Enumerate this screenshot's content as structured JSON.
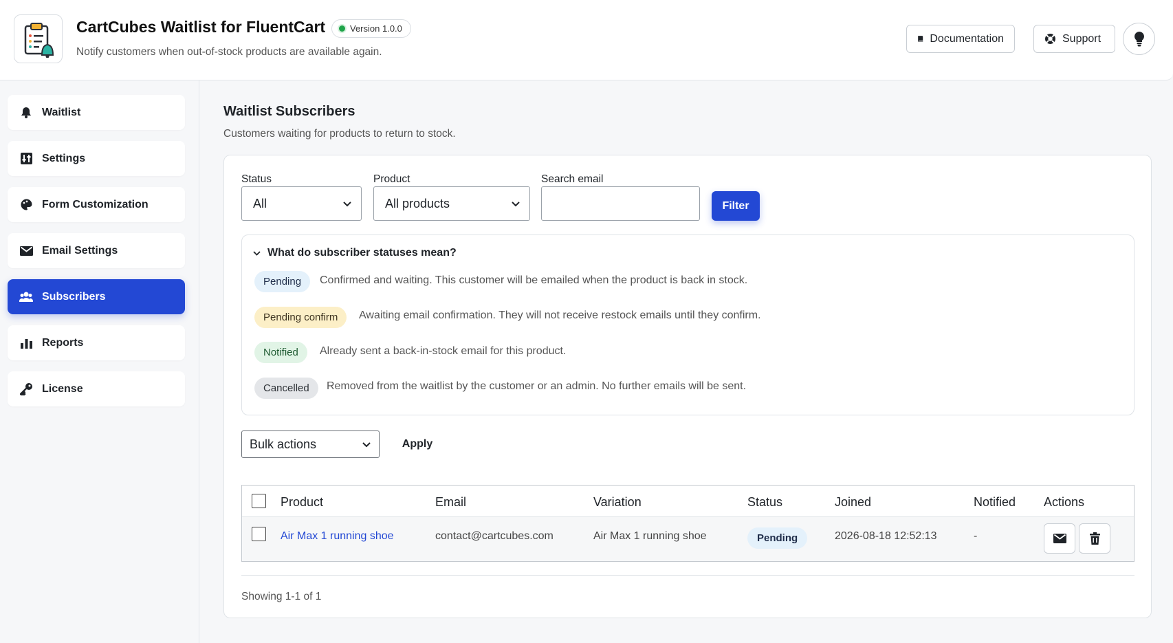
{
  "header": {
    "title": "CartCubes Waitlist for FluentCart",
    "version": "Version 1.0.0",
    "subtitle": "Notify customers when out-of-stock products are available again.",
    "documentation_label": "Documentation",
    "support_label": "Support",
    "logo_icon": "clipboard-bell-icon"
  },
  "sidebar": {
    "items": [
      {
        "label": "Waitlist",
        "icon": "bell-icon"
      },
      {
        "label": "Settings",
        "icon": "sliders-icon"
      },
      {
        "label": "Form Customization",
        "icon": "palette-icon"
      },
      {
        "label": "Email Settings",
        "icon": "envelope-icon"
      },
      {
        "label": "Subscribers",
        "icon": "users-icon",
        "active": true
      },
      {
        "label": "Reports",
        "icon": "bar-chart-icon"
      },
      {
        "label": "License",
        "icon": "key-icon"
      }
    ]
  },
  "main": {
    "title": "Waitlist Subscribers",
    "subtitle": "Customers waiting for products to return to stock.",
    "filters": {
      "status_label": "Status",
      "status_value": "All",
      "product_label": "Product",
      "product_value": "All products",
      "search_label": "Search email",
      "search_value": "",
      "filter_button": "Filter"
    },
    "legend": {
      "heading": "What do subscriber statuses mean?",
      "items": [
        {
          "status": "Pending",
          "description": "Confirmed and waiting. This customer will be emailed when the product is back in stock."
        },
        {
          "status": "Pending confirm",
          "description": "Awaiting email confirmation. They will not receive restock emails until they confirm."
        },
        {
          "status": "Notified",
          "description": "Already sent a back-in-stock email for this product."
        },
        {
          "status": "Cancelled",
          "description": "Removed from the waitlist by the customer or an admin. No further emails will be sent."
        }
      ]
    },
    "bulk": {
      "selected": "Bulk actions",
      "apply_label": "Apply"
    },
    "table": {
      "columns": [
        "Product",
        "Email",
        "Variation",
        "Status",
        "Joined",
        "Notified",
        "Actions"
      ],
      "rows": [
        {
          "product": "Air Max 1 running shoe",
          "email": "contact@cartcubes.com",
          "variation": "Air Max 1 running shoe",
          "status": "Pending",
          "joined": "2026-08-18 12:52:13",
          "notified": "-"
        }
      ]
    },
    "pagination": "Showing 1-1 of 1"
  },
  "colors": {
    "accent": "#2348d4",
    "pending_bg": "#e4f1fb",
    "pending_confirm_bg": "#fcefc7",
    "notified_bg": "#e1f4e6",
    "cancelled_bg": "#e4e6e9",
    "status_dot": "#1fa44a"
  }
}
